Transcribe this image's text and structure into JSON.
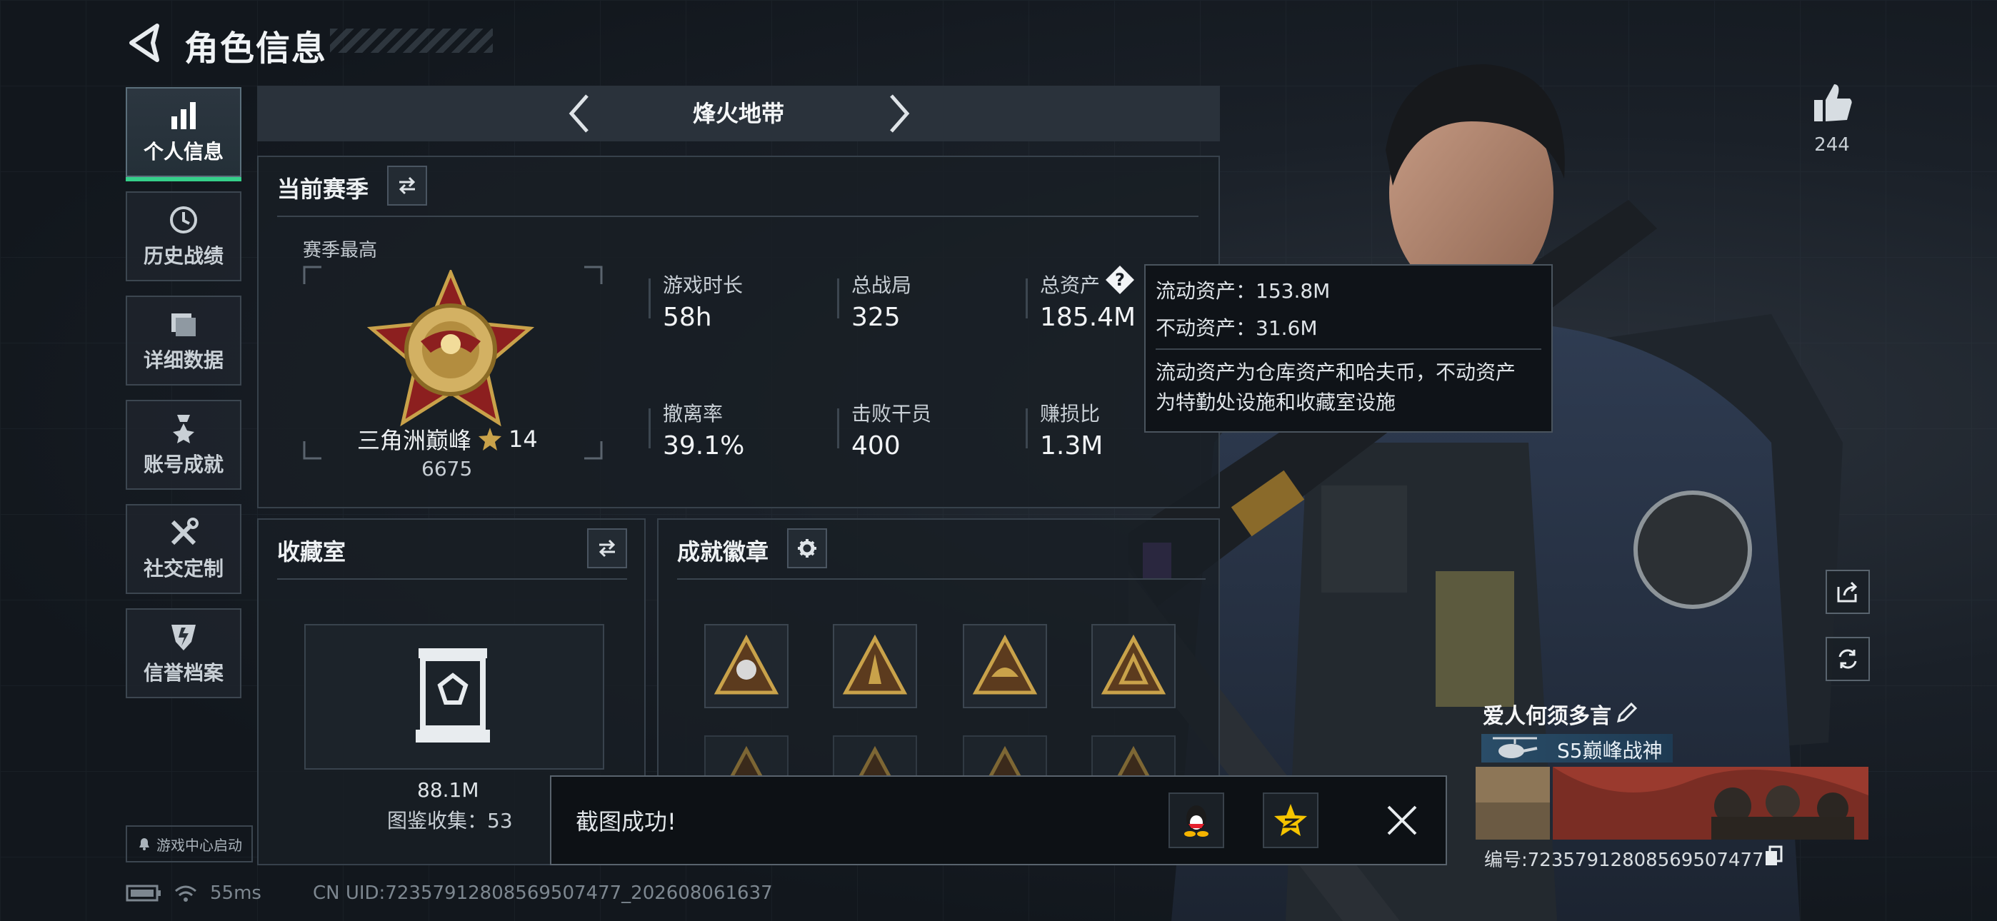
{
  "header": {
    "title": "角色信息"
  },
  "nav": [
    {
      "label": "个人信息",
      "icon": "bar-chart-icon",
      "active": true
    },
    {
      "label": "历史战绩",
      "icon": "history-clock-icon"
    },
    {
      "label": "详细数据",
      "icon": "folder-icon"
    },
    {
      "label": "账号成就",
      "icon": "achievement-medal-icon"
    },
    {
      "label": "社交定制",
      "icon": "tools-icon"
    },
    {
      "label": "信誉档案",
      "icon": "shield-icon"
    }
  ],
  "game_center": {
    "label": "游戏中心启动"
  },
  "mode": {
    "title": "烽火地带"
  },
  "season": {
    "title": "当前赛季",
    "best_label": "赛季最高",
    "rank_name": "三角洲巅峰",
    "rank_stars": "14",
    "rank_points": "6675",
    "stats": [
      {
        "label": "游戏时长",
        "value": "58h"
      },
      {
        "label": "总战局",
        "value": "325"
      },
      {
        "label": "总资产",
        "value": "185.4M"
      },
      {
        "label": "撤离率",
        "value": "39.1%"
      },
      {
        "label": "击败干员",
        "value": "400"
      },
      {
        "label": "赚损比",
        "value": "1.3M"
      }
    ]
  },
  "tooltip": {
    "liquid": "流动资产：153.8M",
    "fixed": "不动资产：31.6M",
    "desc_1": "流动资产为仓库资产和哈夫币，不动资产",
    "desc_2": "为特勤处设施和收藏室设施"
  },
  "collection": {
    "title": "收藏室",
    "value": "88.1M",
    "count_label": "图鉴收集：53"
  },
  "badges": {
    "title": "成就徽章"
  },
  "toast": {
    "text": "截图成功!"
  },
  "likes": {
    "count": "244"
  },
  "player_card": {
    "name": "爱人何须多言",
    "title": "S5巅峰战神",
    "id": "编号:7235791280856950747​7"
  },
  "status": {
    "ping": "55ms",
    "uid": "CN UID:7235791280856950747​7_202608061637"
  },
  "colors": {
    "accent_green": "#35d08a",
    "gold": "#c9a24a"
  }
}
